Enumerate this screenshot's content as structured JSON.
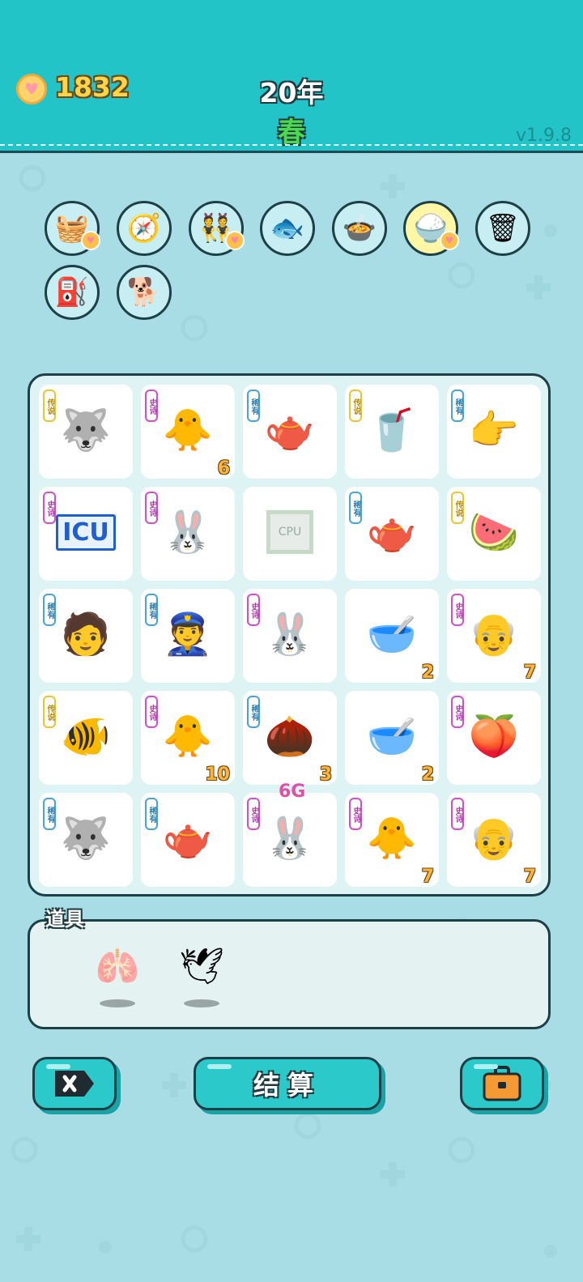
{
  "header": {
    "coins": "1832",
    "year": "20年",
    "season": "春",
    "version": "v1.9.8"
  },
  "abilities": [
    {
      "icon": "fruit-basket-icon",
      "glyph": "🧺",
      "heart": true
    },
    {
      "icon": "compass-icon",
      "glyph": "🧭",
      "heart": false
    },
    {
      "icon": "twin-dolls-icon",
      "glyph": "👯",
      "heart": true
    },
    {
      "icon": "fish-tank-icon",
      "glyph": "🐟",
      "heart": false
    },
    {
      "icon": "cooking-pot-duck-icon",
      "glyph": "🍲",
      "heart": false
    },
    {
      "icon": "rice-bowl-icon",
      "glyph": "🍚",
      "heart": true,
      "gold": true
    },
    {
      "icon": "garbage-bag-recycle-icon",
      "glyph": "🗑",
      "heart": false
    },
    {
      "icon": "air-pump-icon",
      "glyph": "⛽",
      "heart": false
    },
    {
      "icon": "dog-sunglasses-icon",
      "glyph": "🐕",
      "heart": false
    }
  ],
  "board": {
    "rows": [
      [
        {
          "name": "husky-king",
          "glyph": "🐺",
          "tag": "legend",
          "tag_text": "传说",
          "count": ""
        },
        {
          "name": "yellow-egg-sparkle",
          "glyph": "🐥",
          "tag": "epic",
          "tag_text": "史诗",
          "count": "6"
        },
        {
          "name": "teapot",
          "glyph": "🫖",
          "tag": "rare",
          "tag_text": "稀有",
          "count": ""
        },
        {
          "name": "milk-tea-cup",
          "glyph": "🥤",
          "tag": "legend",
          "tag_text": "传说",
          "count": ""
        },
        {
          "name": "pointing-hand",
          "glyph": "👉",
          "tag": "rare",
          "tag_text": "稀有",
          "count": ""
        }
      ],
      [
        {
          "name": "icu-sign",
          "glyph": "",
          "text": "ICU",
          "tag": "epic",
          "tag_text": "史诗",
          "count": ""
        },
        {
          "name": "rabbit-tent",
          "glyph": "🐰",
          "tag": "epic",
          "tag_text": "史诗",
          "count": ""
        },
        {
          "name": "cpu-chip",
          "glyph": "",
          "text": "CPU",
          "tag": "",
          "tag_text": "",
          "count": ""
        },
        {
          "name": "teapot",
          "glyph": "🫖",
          "tag": "rare",
          "tag_text": "稀有",
          "count": ""
        },
        {
          "name": "watermelon",
          "glyph": "🍉",
          "tag": "legend",
          "tag_text": "传说",
          "count": ""
        }
      ],
      [
        {
          "name": "glasses-boy",
          "glyph": "🧑",
          "tag": "rare",
          "tag_text": "稀有",
          "count": ""
        },
        {
          "name": "police-boy",
          "glyph": "👮",
          "tag": "rare",
          "tag_text": "稀有",
          "count": ""
        },
        {
          "name": "rabbit-tent",
          "glyph": "🐰",
          "tag": "epic",
          "tag_text": "史诗",
          "count": ""
        },
        {
          "name": "soup-bowl",
          "glyph": "🥣",
          "tag": "",
          "tag_text": "",
          "count": "2"
        },
        {
          "name": "green-hat-grandpa",
          "glyph": "👴",
          "tag": "epic",
          "tag_text": "史诗",
          "count": "7"
        }
      ],
      [
        {
          "name": "koi-fish",
          "glyph": "🐠",
          "tag": "legend",
          "tag_text": "传说",
          "count": ""
        },
        {
          "name": "yellow-egg",
          "glyph": "🐥",
          "tag": "epic",
          "tag_text": "史诗",
          "count": "10"
        },
        {
          "name": "small-nut",
          "glyph": "🌰",
          "tag": "rare",
          "tag_text": "稀有",
          "count": "3"
        },
        {
          "name": "soup-bowl",
          "glyph": "🥣",
          "tag": "",
          "tag_text": "",
          "count": "2"
        },
        {
          "name": "peach",
          "glyph": "🍑",
          "tag": "epic",
          "tag_text": "史诗",
          "count": ""
        }
      ],
      [
        {
          "name": "husky-sitting",
          "glyph": "🐺",
          "tag": "rare",
          "tag_text": "稀有",
          "count": ""
        },
        {
          "name": "teapot",
          "glyph": "🫖",
          "tag": "rare",
          "tag_text": "稀有",
          "count": ""
        },
        {
          "name": "rabbit-tent-6g",
          "glyph": "🐰",
          "tag": "epic",
          "tag_text": "史诗",
          "count": "",
          "above": "6G"
        },
        {
          "name": "yellow-egg",
          "glyph": "🐥",
          "tag": "epic",
          "tag_text": "史诗",
          "count": "7"
        },
        {
          "name": "green-hat-grandpa",
          "glyph": "👴",
          "tag": "epic",
          "tag_text": "史诗",
          "count": "7"
        }
      ]
    ]
  },
  "tools": {
    "label": "道具",
    "items": [
      {
        "icon": "liver-icon",
        "glyph": "🫁"
      },
      {
        "icon": "white-bird-icon",
        "glyph": "🕊"
      }
    ]
  },
  "buttons": {
    "delete_icon": "delete-icon",
    "settle_label": "结算",
    "bag_icon": "briefcase-icon"
  },
  "colors": {
    "header": "#22c4c7",
    "background": "#a9dde6",
    "board": "#def3f4",
    "coin": "#ffd54a",
    "season": "#4cd94f"
  }
}
